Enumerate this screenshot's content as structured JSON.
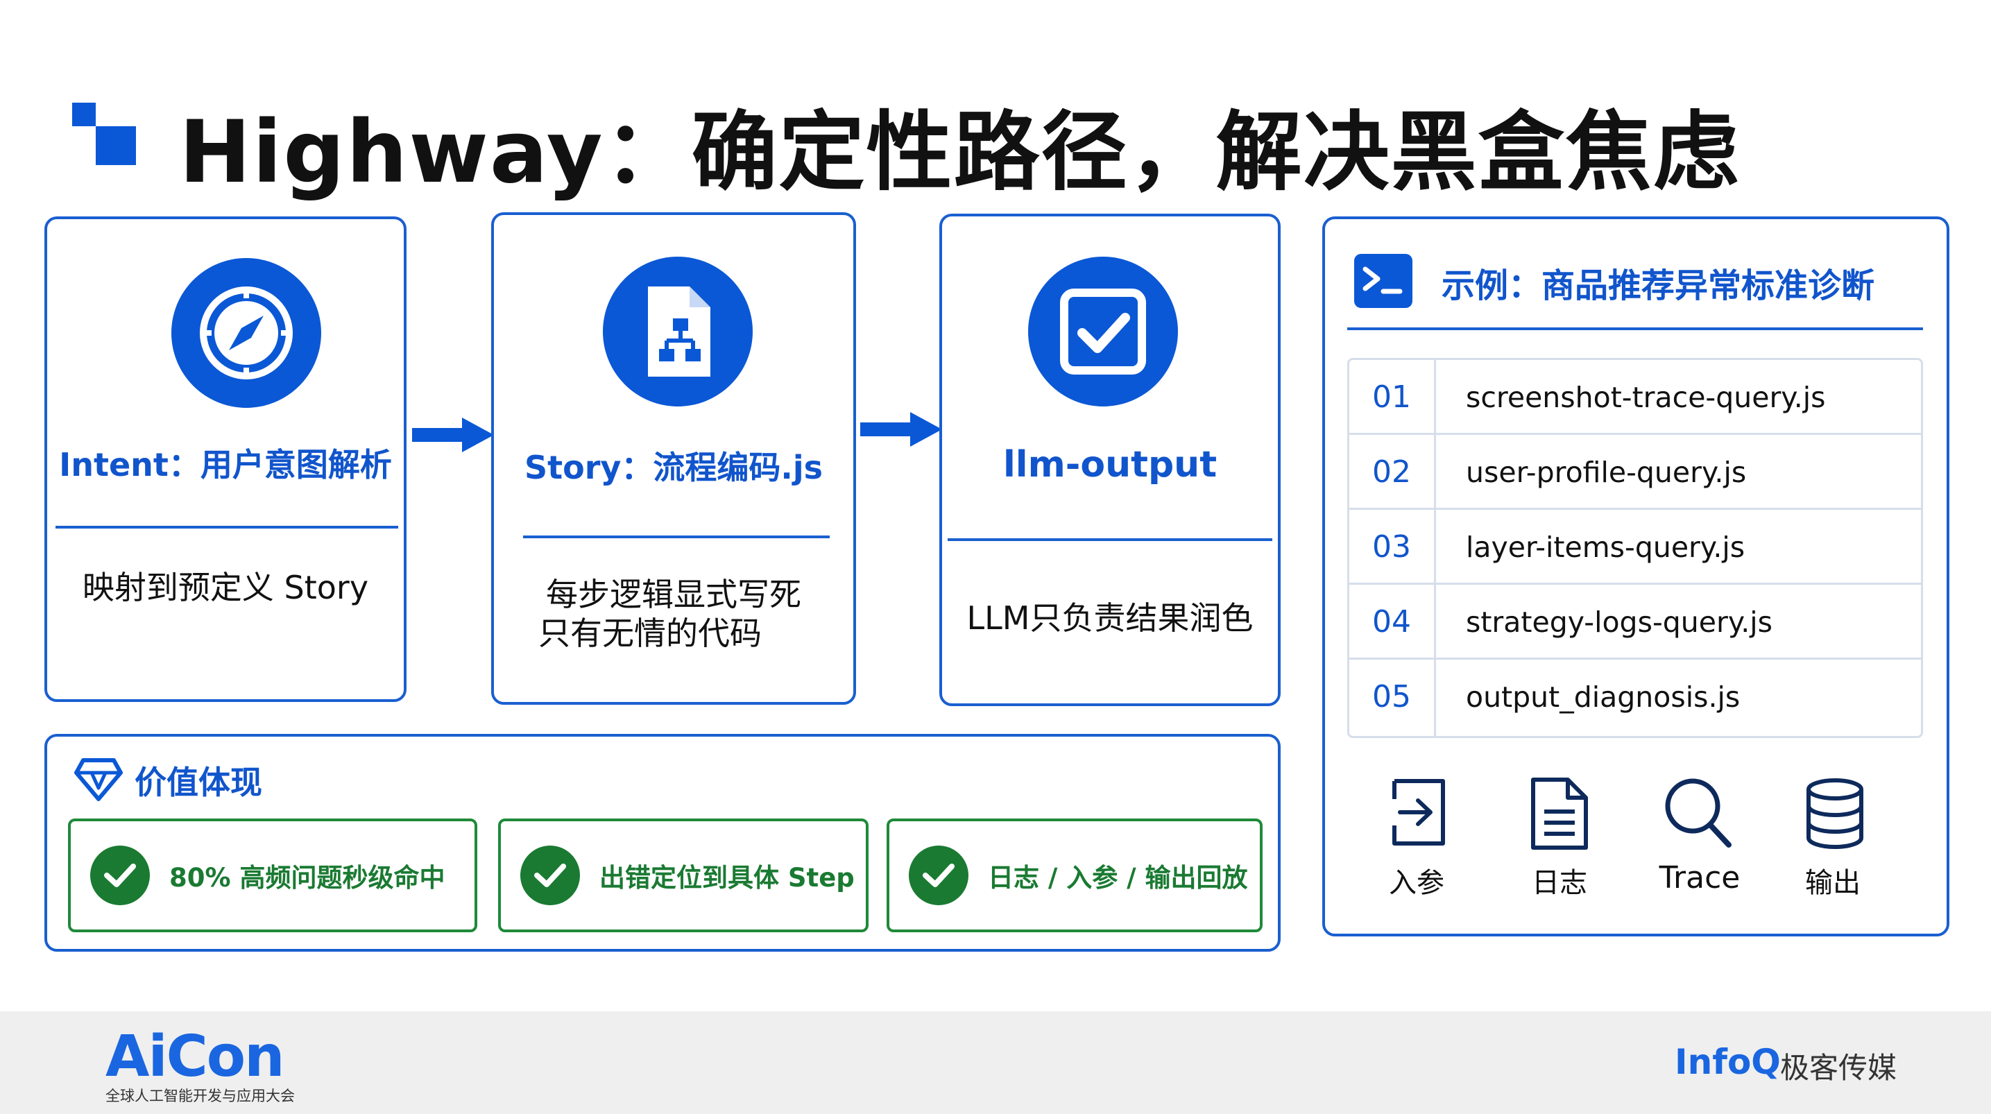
{
  "title": "Highway：确定性路径，解决黑盒焦虑",
  "colors": {
    "accent": "#0b58d6",
    "border": "#1a5fd0",
    "success": "#1a7a32"
  },
  "cards": [
    {
      "icon": "compass-icon",
      "head": "Intent：用户意图解析",
      "body_lines": [
        "映射到预定义 Story"
      ]
    },
    {
      "icon": "flow-document-icon",
      "head": "Story：流程编码.js",
      "body_lines": [
        "每步逻辑显式写死",
        "只有无情的代码"
      ]
    },
    {
      "icon": "checkbox-icon",
      "head": "llm-output",
      "body_lines": [
        "LLM只负责结果润色"
      ]
    }
  ],
  "value": {
    "icon": "diamond-icon",
    "title": "价值体现",
    "items": [
      "80% 高频问题秒级命中",
      "出错定位到具体 Step",
      "日志 / 入参 / 输出回放"
    ]
  },
  "example": {
    "icon": "terminal-icon",
    "title": "示例：商品推荐异常标准诊断",
    "steps": [
      {
        "num": "01",
        "file": "screenshot-trace-query.js"
      },
      {
        "num": "02",
        "file": "user-profile-query.js"
      },
      {
        "num": "03",
        "file": "layer-items-query.js"
      },
      {
        "num": "04",
        "file": "strategy-logs-query.js"
      },
      {
        "num": "05",
        "file": "output_diagnosis.js"
      }
    ],
    "tools": [
      {
        "icon": "input-arrow-icon",
        "label": "入参"
      },
      {
        "icon": "log-document-icon",
        "label": "日志"
      },
      {
        "icon": "magnifier-icon",
        "label": "Trace"
      },
      {
        "icon": "database-icon",
        "label": "输出"
      }
    ]
  },
  "footer": {
    "brand": "AiCon",
    "brand_sub": "全球人工智能开发与应用大会",
    "partner_logo": "InfoQ",
    "partner_name": "极客传媒"
  }
}
